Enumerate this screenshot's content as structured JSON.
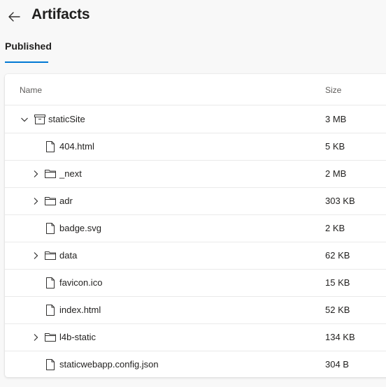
{
  "header": {
    "back_icon": "back-arrow-icon",
    "title": "Artifacts"
  },
  "tabs": [
    {
      "label": "Published",
      "selected": true
    }
  ],
  "accent_color": "#0078d4",
  "table": {
    "columns": {
      "name": "Name",
      "size": "Size"
    },
    "rows": [
      {
        "name": "staticSite",
        "size": "3 MB",
        "kind": "artifact",
        "expandable": true,
        "expanded": true,
        "depth": 0
      },
      {
        "name": "404.html",
        "size": "5 KB",
        "kind": "file",
        "expandable": false,
        "depth": 1
      },
      {
        "name": "_next",
        "size": "2 MB",
        "kind": "folder",
        "expandable": true,
        "expanded": false,
        "depth": 1
      },
      {
        "name": "adr",
        "size": "303 KB",
        "kind": "folder",
        "expandable": true,
        "expanded": false,
        "depth": 1
      },
      {
        "name": "badge.svg",
        "size": "2 KB",
        "kind": "file",
        "expandable": false,
        "depth": 1
      },
      {
        "name": "data",
        "size": "62 KB",
        "kind": "folder",
        "expandable": true,
        "expanded": false,
        "depth": 1
      },
      {
        "name": "favicon.ico",
        "size": "15 KB",
        "kind": "file",
        "expandable": false,
        "depth": 1
      },
      {
        "name": "index.html",
        "size": "52 KB",
        "kind": "file",
        "expandable": false,
        "depth": 1
      },
      {
        "name": "l4b-static",
        "size": "134 KB",
        "kind": "folder",
        "expandable": true,
        "expanded": false,
        "depth": 1
      },
      {
        "name": "staticwebapp.config.json",
        "size": "304 B",
        "kind": "file",
        "expandable": false,
        "depth": 1
      }
    ]
  }
}
